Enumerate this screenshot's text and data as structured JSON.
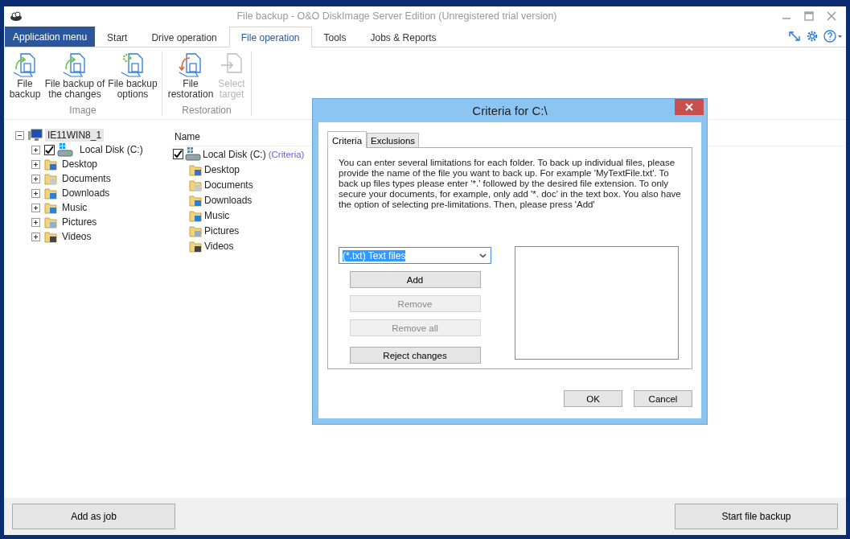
{
  "window": {
    "title": "File backup - O&O DiskImage Server Edition (Unregistered trial version)"
  },
  "tabs": [
    {
      "label": "Application menu",
      "kind": "app",
      "selected": false
    },
    {
      "label": "Start",
      "kind": "tab",
      "selected": false
    },
    {
      "label": "Drive operation",
      "kind": "tab",
      "selected": false
    },
    {
      "label": "File operation",
      "kind": "tab",
      "selected": true
    },
    {
      "label": "Tools",
      "kind": "tab",
      "selected": false
    },
    {
      "label": "Jobs & Reports",
      "kind": "tab",
      "selected": false
    }
  ],
  "ribbon": [
    {
      "group": "Image",
      "buttons": [
        {
          "label": "File backup",
          "disabled": false
        },
        {
          "label": "File backup of the changes",
          "disabled": false
        },
        {
          "label": "File backup options",
          "disabled": false
        }
      ]
    },
    {
      "group": "Restoration",
      "buttons": [
        {
          "label": "File restoration",
          "disabled": false
        },
        {
          "label": "Select target",
          "disabled": true
        }
      ]
    }
  ],
  "tree": [
    {
      "label": "IE11WIN8_1",
      "kind": "computer",
      "selected": true,
      "expanded": true,
      "children": [
        {
          "label": "Local Disk (C:)",
          "kind": "drive",
          "selected": false,
          "checked": true
        },
        {
          "label": "Desktop",
          "kind": "folder",
          "selected": false
        },
        {
          "label": "Documents",
          "kind": "folder",
          "selected": false
        },
        {
          "label": "Downloads",
          "kind": "folder",
          "selected": false
        },
        {
          "label": "Music",
          "kind": "folder",
          "selected": false
        },
        {
          "label": "Pictures",
          "kind": "folder",
          "selected": false
        },
        {
          "label": "Videos",
          "kind": "folder",
          "selected": false
        }
      ]
    }
  ],
  "file_list": {
    "column": "Name",
    "items": [
      {
        "label": "Local Disk (C:)",
        "note": "(Criteria)",
        "checked": true,
        "children": [
          {
            "label": "Desktop"
          },
          {
            "label": "Documents"
          },
          {
            "label": "Downloads"
          },
          {
            "label": "Music"
          },
          {
            "label": "Pictures"
          },
          {
            "label": "Videos"
          }
        ]
      }
    ]
  },
  "dialog": {
    "title": "Criteria for C:\\",
    "tabs": [
      {
        "label": "Criteria",
        "selected": true
      },
      {
        "label": "Exclusions",
        "selected": false
      }
    ],
    "description": "You can enter several limitations for each folder. To back up individual files, please provide the name of the file you want to back up. For example 'MyTextFile.txt'. To back up files types please enter '*.' followed by the desired file extension. To only secure your documents, for example, only add '*. doc' in the text box. You also have the option of selecting pre-limitations. Then, please press 'Add'",
    "filter_value": "(*.txt) Text files",
    "actions": [
      {
        "label": "Add",
        "disabled": false
      },
      {
        "label": "Remove",
        "disabled": true
      },
      {
        "label": "Remove all",
        "disabled": true
      },
      {
        "label": "Reject changes",
        "disabled": false
      }
    ],
    "buttons": [
      "OK",
      "Cancel"
    ]
  },
  "footer": {
    "buttons": [
      "Add as job",
      "Start file backup"
    ]
  }
}
